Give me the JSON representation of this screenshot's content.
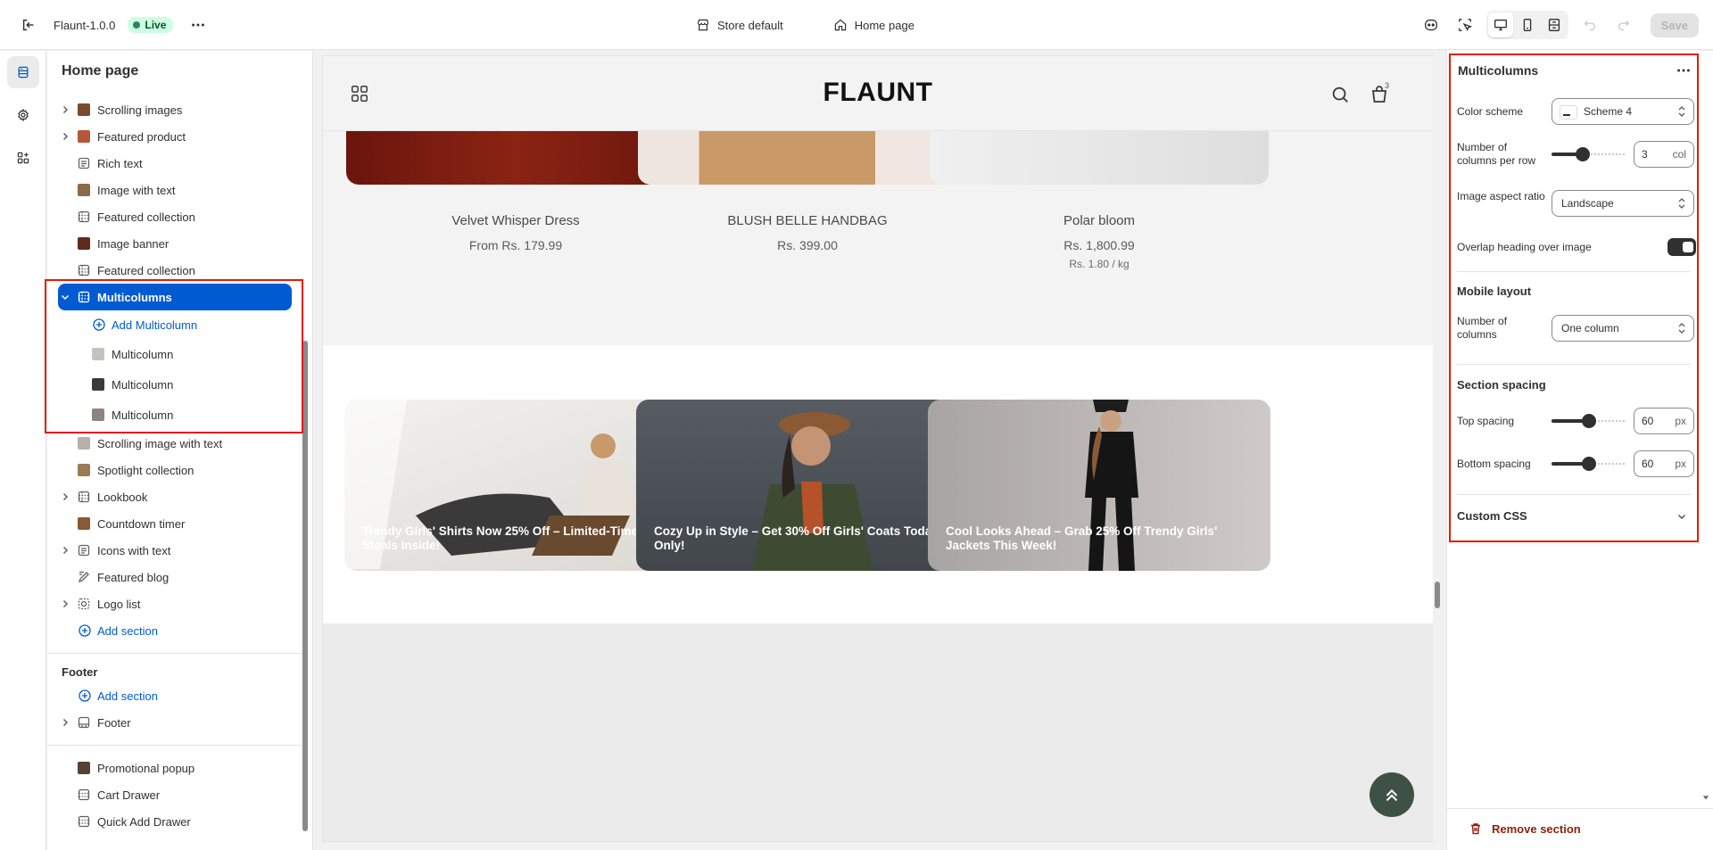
{
  "topbar": {
    "theme_name": "Flaunt-1.0.0",
    "live_label": "Live",
    "store_label": "Store default",
    "page_label": "Home page",
    "save_label": "Save"
  },
  "sidebar": {
    "title": "Home page",
    "items": [
      {
        "label": "Scrolling images",
        "chevron": true,
        "thumb": "#7a4a2e"
      },
      {
        "label": "Featured product",
        "chevron": true,
        "thumb": "#b5583a"
      },
      {
        "label": "Rich text",
        "chevron": false,
        "icon": "text"
      },
      {
        "label": "Image with text",
        "chevron": false,
        "thumb": "#8a6a4a"
      },
      {
        "label": "Featured collection",
        "chevron": false,
        "icon": "grid"
      },
      {
        "label": "Image banner",
        "chevron": false,
        "thumb": "#5e2b1d"
      },
      {
        "label": "Featured collection",
        "chevron": false,
        "icon": "grid"
      }
    ],
    "selected": {
      "label": "Multicolumns"
    },
    "add_multicolumn": "Add Multicolumn",
    "children": [
      {
        "label": "Multicolumn",
        "thumb": "#c7c2bb"
      },
      {
        "label": "Multicolumn",
        "thumb": "#3a3a3a"
      },
      {
        "label": "Multicolumn",
        "thumb": "#8c8480"
      }
    ],
    "items_after": [
      {
        "label": "Scrolling image with text",
        "chevron": false,
        "thumb": "#b7b0a8"
      },
      {
        "label": "Spotlight collection",
        "chevron": false,
        "thumb": "#9a7b52"
      },
      {
        "label": "Lookbook",
        "chevron": true,
        "icon": "grid"
      },
      {
        "label": "Countdown timer",
        "chevron": false,
        "thumb": "#8a5a32"
      },
      {
        "label": "Icons with text",
        "chevron": true,
        "icon": "text"
      },
      {
        "label": "Featured blog",
        "chevron": false,
        "icon": "blog"
      },
      {
        "label": "Logo list",
        "chevron": true,
        "icon": "logo"
      }
    ],
    "add_section": "Add section",
    "footer_title": "Footer",
    "footer_add_section": "Add section",
    "footer_item": "Footer",
    "overlays": [
      {
        "label": "Promotional popup",
        "thumb": "#5a4030"
      },
      {
        "label": "Cart Drawer",
        "icon": "grid"
      },
      {
        "label": "Quick Add Drawer",
        "icon": "grid"
      }
    ]
  },
  "preview": {
    "logo": "FLAUNT",
    "cart_count": "3",
    "products": [
      {
        "name": "Velvet Whisper Dress",
        "price": "From Rs. 179.99",
        "unit": "",
        "color": "#7d1a10"
      },
      {
        "name": "BLUSH BELLE HANDBAG",
        "price": "Rs. 399.00",
        "unit": "",
        "color": "#c79a6b"
      },
      {
        "name": "Polar bloom",
        "price": "Rs. 1,800.99",
        "unit": "Rs. 1.80 / kg",
        "color": "#dcdcdc"
      }
    ],
    "cards": [
      {
        "caption": "Trendy Girls' Shirts Now 25% Off – Limited-Time Style Steals Inside!",
        "bg": "#e9e7e4"
      },
      {
        "caption": "Cozy Up in Style – Get 30% Off Girls' Coats Today Only!",
        "bg": "#4b5157"
      },
      {
        "caption": "Cool Looks Ahead – Grab 25% Off Trendy Girls' Jackets This Week!",
        "bg": "#b3afad"
      }
    ]
  },
  "panel": {
    "title": "Multicolumns",
    "color_scheme_label": "Color scheme",
    "color_scheme_value": "Scheme 4",
    "columns_label": "Number of columns per row",
    "columns_value": "3",
    "columns_unit": "col",
    "columns_fraction": 0.4,
    "aspect_label": "Image aspect ratio",
    "aspect_value": "Landscape",
    "overlay_label": "Overlap heading over image",
    "mobile_title": "Mobile layout",
    "mobile_columns_label": "Number of columns",
    "mobile_columns_value": "One column",
    "spacing_title": "Section spacing",
    "top_spacing_label": "Top spacing",
    "top_spacing_value": "60",
    "bottom_spacing_label": "Bottom spacing",
    "bottom_spacing_value": "60",
    "spacing_unit": "px",
    "spacing_fraction": 0.5,
    "custom_css_label": "Custom CSS",
    "remove_label": "Remove section"
  }
}
